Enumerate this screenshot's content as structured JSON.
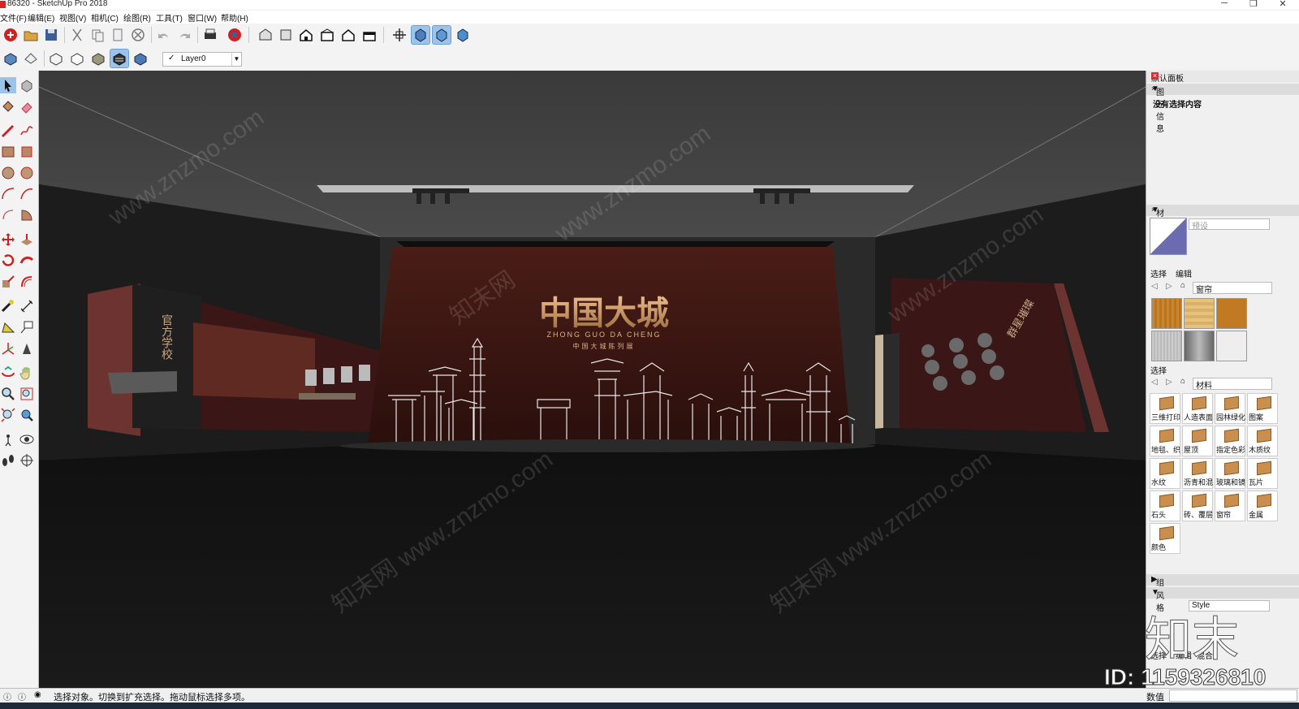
{
  "window": {
    "title": "86320 - SketchUp Pro 2018",
    "controls": {
      "minimize": "─",
      "restore": "❐",
      "close": "✕"
    }
  },
  "menubar": {
    "items": [
      "文件(F)",
      "编辑(E)",
      "视图(V)",
      "相机(C)",
      "绘图(R)",
      "工具(T)",
      "窗口(W)",
      "帮助(H)"
    ]
  },
  "layers": {
    "current": "Layer0",
    "checked": "✓"
  },
  "scene": {
    "headline": "中国大城",
    "pinyin": "ZHONG GUO DA CHENG",
    "subtitle": "中国大城陈列展",
    "left_panel_title": "官方学校",
    "right_panel_title": "群星璀璨"
  },
  "watermarks": [
    "www.znzmo.com",
    "知末网",
    "www.znzmo.com",
    "知末网 www.znzmo.com",
    "知末网 www.znzmo.com",
    "www.znzmo.com"
  ],
  "tray": {
    "title": "默认面板",
    "entity_info": {
      "header": "图元信息",
      "empty_text": "没有选择内容"
    },
    "materials": {
      "header": "材料",
      "name_placeholder": "预设",
      "tab_select": "选择",
      "tab_edit": "编辑",
      "dropdown1": "窗帘",
      "select_label": "选择",
      "dropdown2": "材料",
      "folders": [
        "三维打印",
        "人造表面",
        "园林绿化",
        "图案",
        "地毯、织物",
        "屋顶",
        "指定色彩",
        "木质纹",
        "水纹",
        "沥青和混凝土",
        "玻璃和镜子",
        "瓦片",
        "石头",
        "砖、覆层",
        "窗帘",
        "金属",
        "颜色"
      ]
    },
    "components": {
      "header": "组件"
    },
    "styles": {
      "header": "风格",
      "name_field": "Style",
      "tab_select": "选择",
      "tab_edit": "编辑",
      "tab_mix": "混合"
    }
  },
  "status": {
    "message": "选择对象。切换到扩充选择。拖动鼠标选择多项。",
    "value_label": "数值"
  },
  "overlay": {
    "id_text": "ID: 1159326810",
    "brand": "知末"
  }
}
